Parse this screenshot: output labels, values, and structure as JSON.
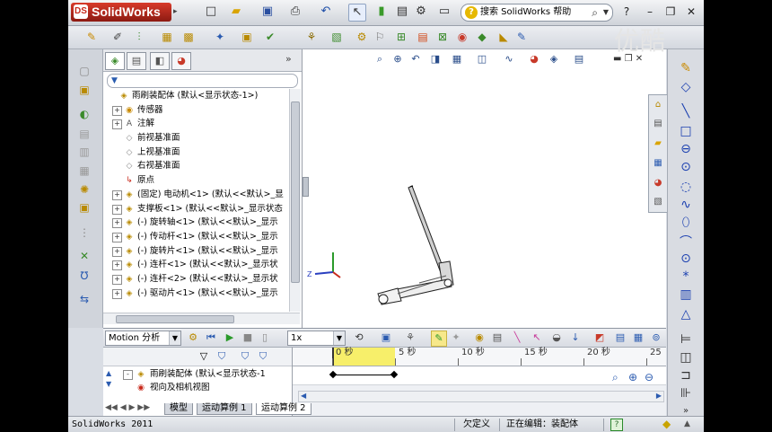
{
  "app": {
    "name": "SolidWorks",
    "logo_mark": "DS"
  },
  "title_toolbar": {
    "icons": [
      "new-icon",
      "open-icon",
      "save-icon",
      "print-icon",
      "undo-icon",
      "select-arrow-icon",
      "rebuild-icon",
      "file-properties-icon",
      "options-icon",
      "view-icon"
    ],
    "search_placeholder": "搜索 SolidWorks 帮助"
  },
  "command_manager_icons": [
    "smart-dimension-icon",
    "sketch-icon",
    "features-icon",
    "mate-icon",
    "linear-pattern-icon",
    "smart-fasteners-icon",
    "move-component-icon",
    "show-hidden-icon",
    "assembly-features-icon",
    "reference-geometry-icon",
    "new-motion-study-icon",
    "bill-of-materials-icon",
    "exploded-view-icon",
    "explode-line-icon",
    "interference-icon",
    "clearance-icon",
    "hole-align-icon",
    "measure-icon",
    "instant3d-icon"
  ],
  "feature_manager": {
    "tabs": [
      "featuremanager-tab",
      "propertymanager-tab",
      "configurationmanager-tab",
      "appearance-tab"
    ],
    "collapse_glyph": "»",
    "filter_glyph": "▼",
    "tree": [
      {
        "level": 0,
        "exp": "",
        "icon": "assembly",
        "label": "雨刷装配体  (默认<显示状态-1>)"
      },
      {
        "level": 1,
        "exp": "+",
        "icon": "sensor",
        "label": "传感器"
      },
      {
        "level": 1,
        "exp": "+",
        "icon": "annotation",
        "label": "注解"
      },
      {
        "level": 1,
        "exp": "",
        "icon": "plane",
        "label": "前视基准面"
      },
      {
        "level": 1,
        "exp": "",
        "icon": "plane",
        "label": "上视基准面"
      },
      {
        "level": 1,
        "exp": "",
        "icon": "plane",
        "label": "右视基准面"
      },
      {
        "level": 1,
        "exp": "",
        "icon": "origin",
        "label": "原点"
      },
      {
        "level": 1,
        "exp": "+",
        "icon": "part",
        "label": "(固定) 电动机<1> (默认<<默认>_显"
      },
      {
        "level": 1,
        "exp": "+",
        "icon": "part",
        "label": "支撑板<1> (默认<<默认>_显示状态"
      },
      {
        "level": 1,
        "exp": "+",
        "icon": "part",
        "label": "(-) 旋转轴<1> (默认<<默认>_显示"
      },
      {
        "level": 1,
        "exp": "+",
        "icon": "part",
        "label": "(-) 传动杆<1> (默认<<默认>_显示"
      },
      {
        "level": 1,
        "exp": "+",
        "icon": "part",
        "label": "(-) 旋转片<1> (默认<<默认>_显示"
      },
      {
        "level": 1,
        "exp": "+",
        "icon": "part",
        "label": "(-) 连杆<1> (默认<<默认>_显示状"
      },
      {
        "level": 1,
        "exp": "+",
        "icon": "part",
        "label": "(-) 连杆<2> (默认<<默认>_显示状"
      },
      {
        "level": 1,
        "exp": "+",
        "icon": "part",
        "label": "(-) 驱动片<1> (默认<<默认>_显示"
      }
    ]
  },
  "heads_up_icons": [
    "zoom-to-fit-icon",
    "zoom-area-icon",
    "previous-view-icon",
    "section-view-icon",
    "view-orientation-icon",
    "display-style-icon",
    "hide-show-icon",
    "edit-appearance-icon",
    "apply-scene-icon",
    "view-settings-icon"
  ],
  "task_pane_icons": [
    "resources-icon",
    "design-library-icon",
    "file-explorer-icon",
    "view-palette-icon",
    "appearances-icon",
    "custom-properties-icon"
  ],
  "right_toolbar_icons": [
    "sketch-icon",
    "smart-dimension-icon",
    "line-icon",
    "rectangle-icon",
    "slot-icon",
    "circle-icon",
    "arc-icon",
    "spline-icon",
    "ellipse-icon",
    "fillet-icon",
    "plane-icon",
    "point-icon",
    "centerline-icon",
    "text-icon",
    "trim-icon",
    "convert-icon",
    "offset-icon",
    "mirror-icon",
    "pattern-icon"
  ],
  "motion_manager": {
    "study_type": "Motion 分析",
    "playback_speed": "1x",
    "toolbar_icons": [
      "calculate-icon",
      "play-from-start-icon",
      "play-icon",
      "stop-icon",
      "playback-speed-icon",
      "save-animation-icon",
      "animation-wizard-icon",
      "autokey-icon",
      "add-key-icon",
      "motor-icon",
      "spring-icon",
      "damper-icon",
      "force-icon",
      "contact-icon",
      "gravity-icon",
      "results-icon",
      "study-properties-icon",
      "collapse-icon"
    ],
    "filter_icons": [
      "filter-animated-icon",
      "filter-driving-icon",
      "filter-selected-icon",
      "filter-results-icon"
    ],
    "ruler_labels": [
      "0 秒",
      "5 秒",
      "10 秒",
      "15 秒",
      "20 秒",
      "25"
    ],
    "tree": [
      {
        "exp": "-",
        "label": "雨刷装配体    (默认<显示状态-1"
      },
      {
        "exp": "",
        "label": "视向及相机视图"
      }
    ]
  },
  "bottom_tabs": [
    "模型",
    "运动算例 1",
    "运动算例 2"
  ],
  "active_tab_index": 2,
  "status_bar": {
    "version": "SolidWorks 2011",
    "state": "欠定义",
    "editing": "正在编辑：装配体",
    "help": "?"
  },
  "watermark": "优酷"
}
